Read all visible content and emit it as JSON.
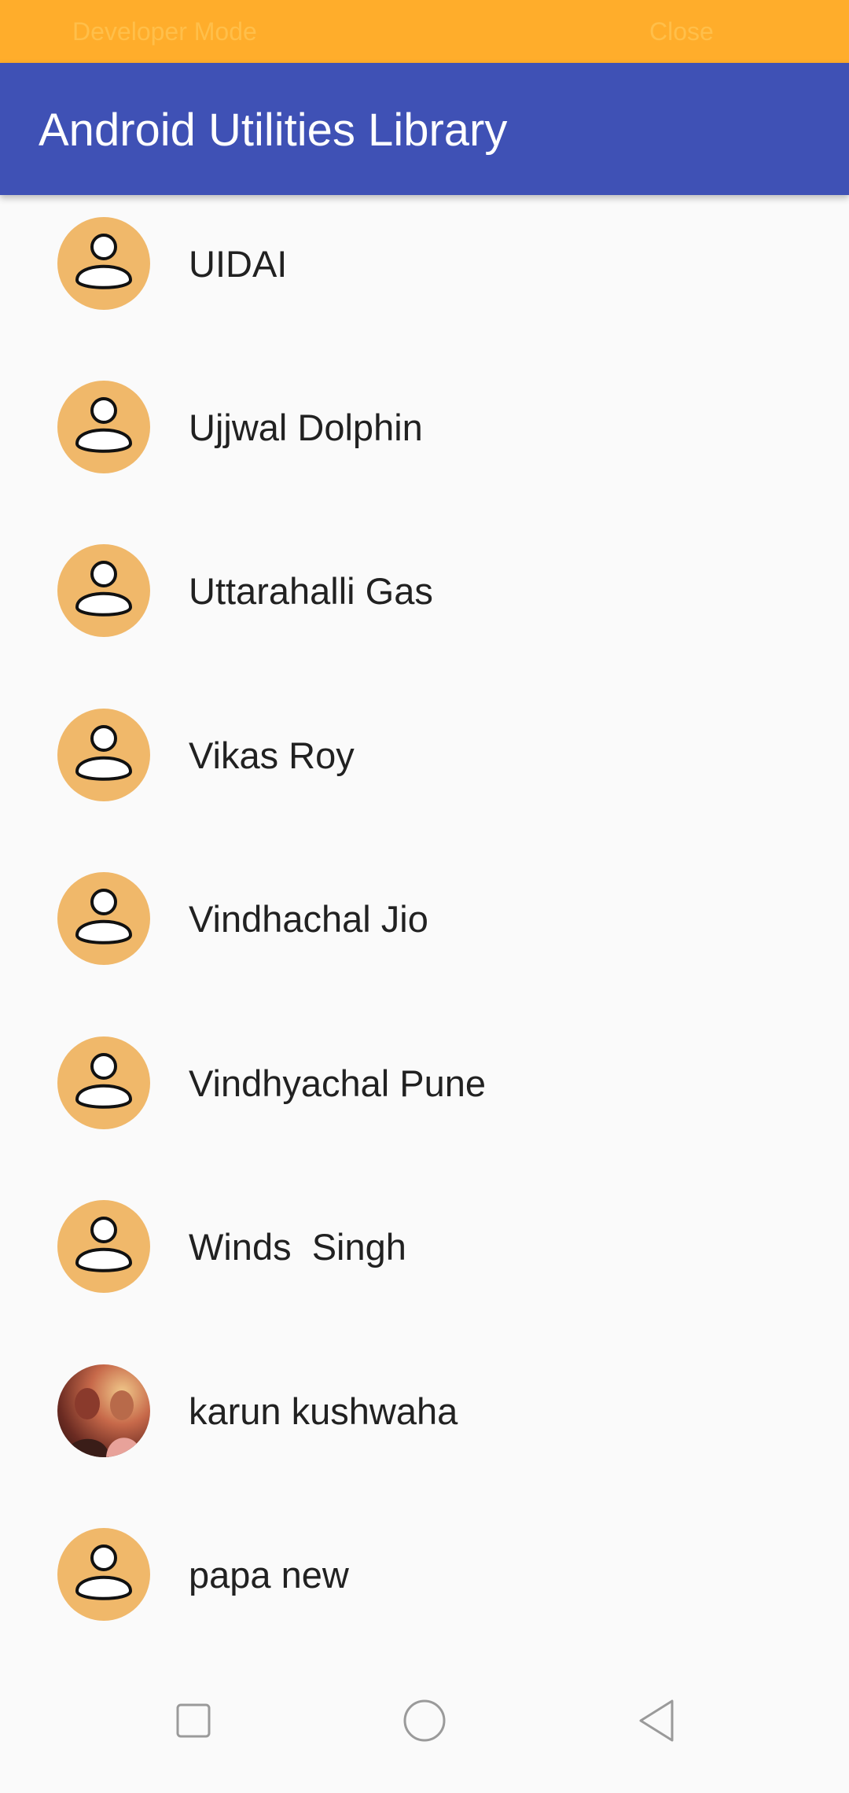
{
  "status_bar": {
    "developer_mode": "Developer Mode",
    "close": "Close"
  },
  "app_bar": {
    "title": "Android Utilities Library"
  },
  "contacts": [
    {
      "name": "UIDAI",
      "avatar": "person-icon"
    },
    {
      "name": "Ujjwal Dolphin",
      "avatar": "person-icon"
    },
    {
      "name": "Uttarahalli Gas",
      "avatar": "person-icon"
    },
    {
      "name": "Vikas Roy",
      "avatar": "person-icon"
    },
    {
      "name": "Vindhachal Jio",
      "avatar": "person-icon"
    },
    {
      "name": "Vindhyachal Pune",
      "avatar": "person-icon"
    },
    {
      "name": "Winds  Singh",
      "avatar": "person-icon"
    },
    {
      "name": "karun kushwaha",
      "avatar": "photo"
    },
    {
      "name": "papa new",
      "avatar": "person-icon"
    }
  ],
  "colors": {
    "status_bar": "#ffad2b",
    "app_bar": "#3f51b5",
    "avatar_bg": "#f0b86a"
  },
  "nav_bar": {
    "icons": [
      "recents-square-icon",
      "home-circle-icon",
      "back-triangle-icon"
    ]
  }
}
